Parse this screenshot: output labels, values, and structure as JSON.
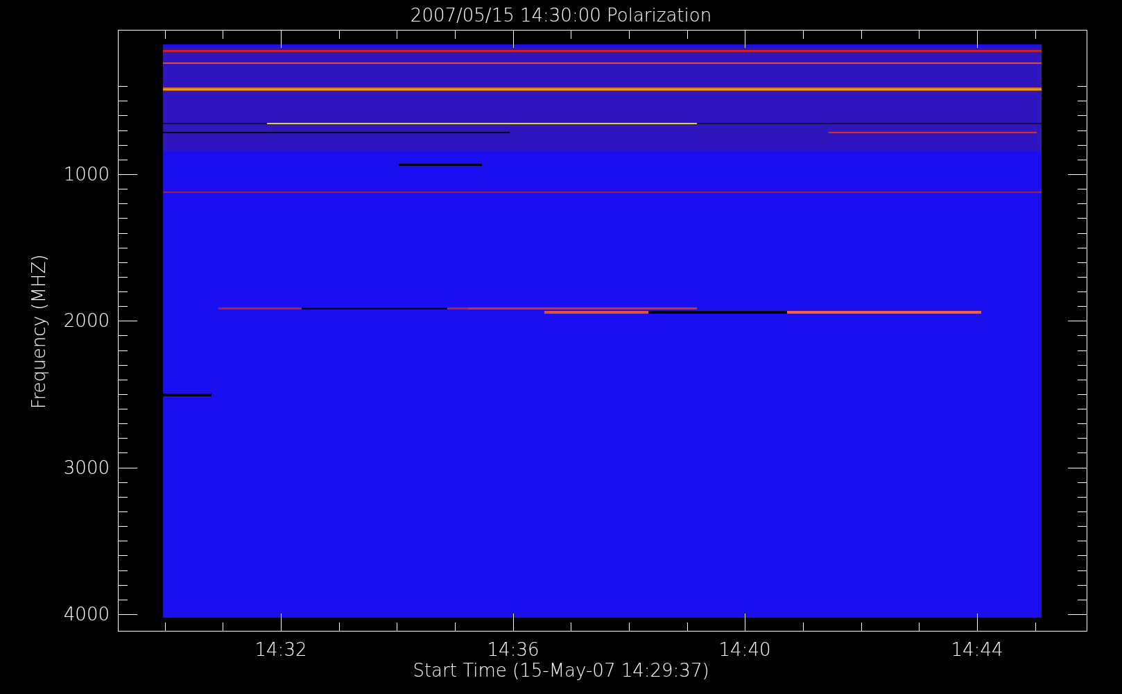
{
  "title": "2007/05/15 14:30:00 Polarization",
  "y_axis": {
    "label": "Frequency (MHZ)",
    "tick_labels": [
      "1000",
      "2000",
      "3000",
      "4000"
    ]
  },
  "x_axis": {
    "label": "Start Time (15-May-07 14:29:37)",
    "tick_labels": [
      "14:32",
      "14:36",
      "14:40",
      "14:44"
    ]
  }
}
